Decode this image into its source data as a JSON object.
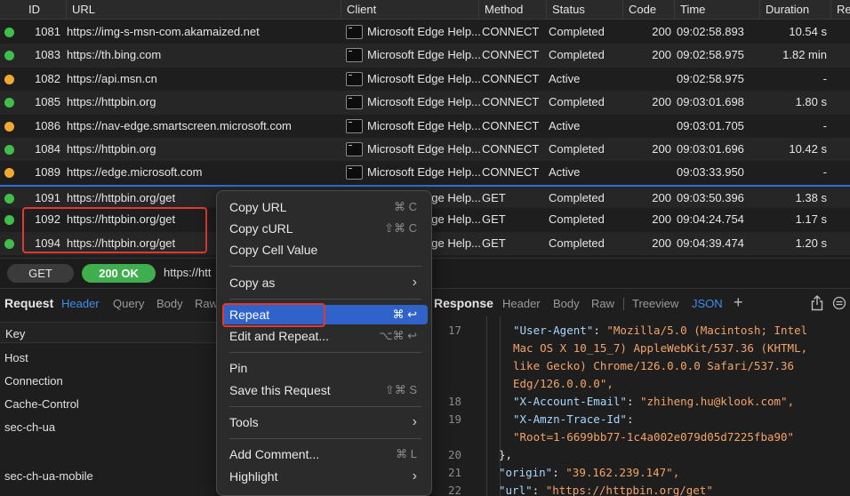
{
  "table": {
    "columns": [
      "ID",
      "URL",
      "Client",
      "Method",
      "Status",
      "Code",
      "Time",
      "Duration",
      "Re"
    ],
    "rows": [
      {
        "id": "1081",
        "url": "https://img-s-msn-com.akamaized.net",
        "client": "Microsoft Edge Help...",
        "method": "CONNECT",
        "status": "Completed",
        "code": "200",
        "time": "09:02:58.893",
        "duration": "10.54 s",
        "dot": "#3fbf4a"
      },
      {
        "id": "1083",
        "url": "https://th.bing.com",
        "client": "Microsoft Edge Help...",
        "method": "CONNECT",
        "status": "Completed",
        "code": "200",
        "time": "09:02:58.975",
        "duration": "1.82 min",
        "dot": "#3fbf4a"
      },
      {
        "id": "1082",
        "url": "https://api.msn.cn",
        "client": "Microsoft Edge Help...",
        "method": "CONNECT",
        "status": "Active",
        "code": "",
        "time": "09:02:58.975",
        "duration": "-",
        "dot": "#f0a832"
      },
      {
        "id": "1085",
        "url": "https://httpbin.org",
        "client": "Microsoft Edge Help...",
        "method": "CONNECT",
        "status": "Completed",
        "code": "200",
        "time": "09:03:01.698",
        "duration": "1.80 s",
        "dot": "#3fbf4a"
      },
      {
        "id": "1086",
        "url": "https://nav-edge.smartscreen.microsoft.com",
        "client": "Microsoft Edge Help...",
        "method": "CONNECT",
        "status": "Active",
        "code": "",
        "time": "09:03:01.705",
        "duration": "-",
        "dot": "#f0a832"
      },
      {
        "id": "1084",
        "url": "https://httpbin.org",
        "client": "Microsoft Edge Help...",
        "method": "CONNECT",
        "status": "Completed",
        "code": "200",
        "time": "09:03:01.696",
        "duration": "10.42 s",
        "dot": "#3fbf4a"
      },
      {
        "id": "1089",
        "url": "https://edge.microsoft.com",
        "client": "Microsoft Edge Help...",
        "method": "CONNECT",
        "status": "Active",
        "code": "",
        "time": "09:03:33.950",
        "duration": "-",
        "dot": "#f0a832"
      },
      {
        "id": "1091",
        "url": "https://httpbin.org/get",
        "client": "Microsoft Edge Help...",
        "method": "GET",
        "status": "Completed",
        "code": "200",
        "time": "09:03:50.396",
        "duration": "1.38 s",
        "dot": "#3fbf4a"
      },
      {
        "id": "1092",
        "url": "https://httpbin.org/get",
        "client": "Microsoft Edge Help...",
        "method": "GET",
        "status": "Completed",
        "code": "200",
        "time": "09:04:24.754",
        "duration": "1.17 s",
        "dot": "#3fbf4a"
      },
      {
        "id": "1094",
        "url": "https://httpbin.org/get",
        "client": "Microsoft Edge Help...",
        "method": "GET",
        "status": "Completed",
        "code": "200",
        "time": "09:04:39.474",
        "duration": "1.20 s",
        "dot": "#3fbf4a"
      }
    ]
  },
  "urlbar": {
    "method": "GET",
    "status": "200 OK",
    "url": "https://htt"
  },
  "request": {
    "title": "Request",
    "tabs": [
      "Header",
      "Query",
      "Body",
      "Raw"
    ],
    "key_header": "Key",
    "keys": [
      "Host",
      "Connection",
      "Cache-Control",
      "sec-ch-ua",
      "sec-ch-ua-mobile"
    ]
  },
  "response": {
    "title": "Response",
    "tabs": [
      "Header",
      "Body",
      "Raw",
      "Treeview",
      "JSON"
    ],
    "add_label": "+",
    "lines": [
      {
        "n": "17",
        "key": "\"User-Agent\"",
        "val": "\"Mozilla/5.0 (Macintosh; Intel"
      },
      {
        "n": "",
        "key": "",
        "val": "Mac OS X 10_15_7) AppleWebKit/537.36 (KHTML,"
      },
      {
        "n": "",
        "key": "",
        "val": "like Gecko) Chrome/126.0.0.0 Safari/537.36"
      },
      {
        "n": "",
        "key": "",
        "val": "Edg/126.0.0.0\","
      },
      {
        "n": "18",
        "key": "\"X-Account-Email\"",
        "val": "\"zhiheng.hu@klook.com\","
      },
      {
        "n": "19",
        "key": "\"X-Amzn-Trace-Id\"",
        "val": ""
      },
      {
        "n": "",
        "key": "",
        "val": "\"Root=1-6699bb77-1c4a002e079d05d7225fba90\""
      },
      {
        "n": "20",
        "key": "",
        "val": "},"
      },
      {
        "n": "21",
        "key": "\"origin\"",
        "val": "\"39.162.239.147\","
      },
      {
        "n": "22",
        "key": "\"url\"",
        "val": "\"https://httpbin.org/get\""
      }
    ]
  },
  "context_menu": {
    "copy_url": "Copy URL",
    "copy_url_sc": "⌘ C",
    "copy_curl": "Copy cURL",
    "copy_curl_sc": "⇧⌘ C",
    "copy_cell": "Copy Cell Value",
    "copy_as": "Copy as",
    "repeat": "Repeat",
    "repeat_sc": "⌘ ↩",
    "edit_repeat": "Edit and Repeat...",
    "edit_repeat_sc": "⌥⌘ ↩",
    "pin": "Pin",
    "save": "Save this Request",
    "save_sc": "⇧⌘ S",
    "tools": "Tools",
    "add_comment": "Add Comment...",
    "add_comment_sc": "⌘ L",
    "highlight": "Highlight"
  },
  "colors": {
    "accent": "#2f63c9",
    "success": "#3fbf4a",
    "warning": "#f0a832",
    "annotation": "#e0392f"
  }
}
